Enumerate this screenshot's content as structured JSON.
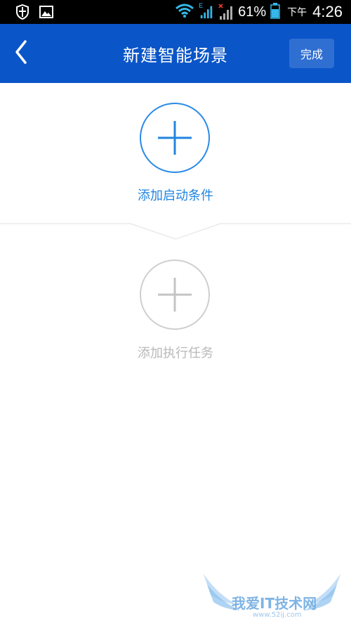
{
  "status_bar": {
    "network_type": "E",
    "battery_percent": "61%",
    "am_pm": "下午",
    "time": "4:26",
    "icons": [
      "shield-icon",
      "image-icon",
      "wifi-icon",
      "signal-icon",
      "signal-no-service-icon",
      "battery-icon"
    ]
  },
  "header": {
    "title": "新建智能场景",
    "done_label": "完成",
    "back_icon": "chevron-left-icon"
  },
  "main": {
    "trigger": {
      "label": "添加启动条件",
      "icon": "plus-icon"
    },
    "task": {
      "label": "添加执行任务",
      "icon": "plus-icon"
    }
  },
  "watermark": {
    "text": "我爱IT技术网",
    "url": "www.52ij.com"
  },
  "colors": {
    "header_bg": "#0a55c8",
    "accent": "#2185e0",
    "disabled": "#b8b8b8"
  }
}
